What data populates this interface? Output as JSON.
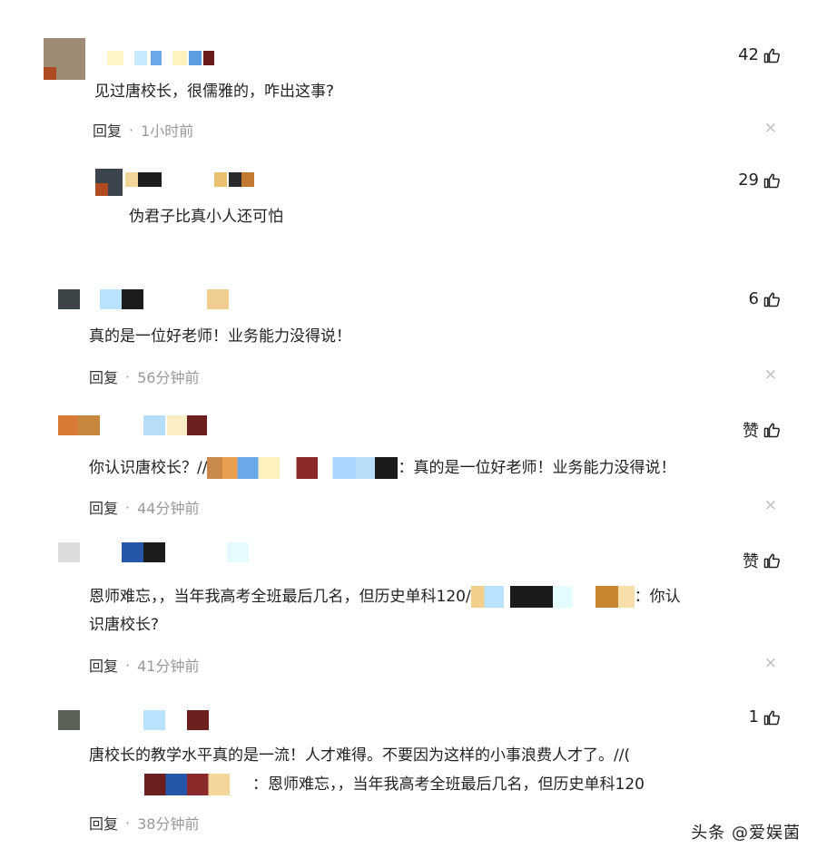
{
  "comments": [
    {
      "likes": "42",
      "text": "见过唐校长，很儒雅的，咋出这事?",
      "reply_label": "回复",
      "time": "1小时前"
    },
    {
      "likes": "29",
      "text": "伪君子比真小人还可怕"
    },
    {
      "likes": "6",
      "text": "真的是一位好老师！业务能力没得说！",
      "reply_label": "回复",
      "time": "56分钟前"
    },
    {
      "likes": "赞",
      "text_prefix": "你认识唐校长？//",
      "text_suffix": "：真的是一位好老师！业务能力没得说！",
      "reply_label": "回复",
      "time": "44分钟前"
    },
    {
      "likes": "赞",
      "text_line1_prefix": "恩师难忘，，当年我高考全班最后几名，但历史单科120/",
      "text_line1_suffix": "：你认",
      "text_line2": "识唐校长?",
      "reply_label": "回复",
      "time": "41分钟前"
    },
    {
      "likes": "1",
      "text_line1": "唐校长的教学水平真的是一流！人才难得。不要因为这样的小事浪费人才了。//(",
      "text_line2_suffix": "：恩师难忘，，当年我高考全班最后几名，但历史单科120",
      "reply_label": "回复",
      "time": "38分钟前"
    }
  ],
  "separator": "·",
  "close_glyph": "×",
  "icons": {
    "like": "thumbs-up-icon",
    "close": "close-icon"
  },
  "watermark": "头条 @爱娱菌"
}
